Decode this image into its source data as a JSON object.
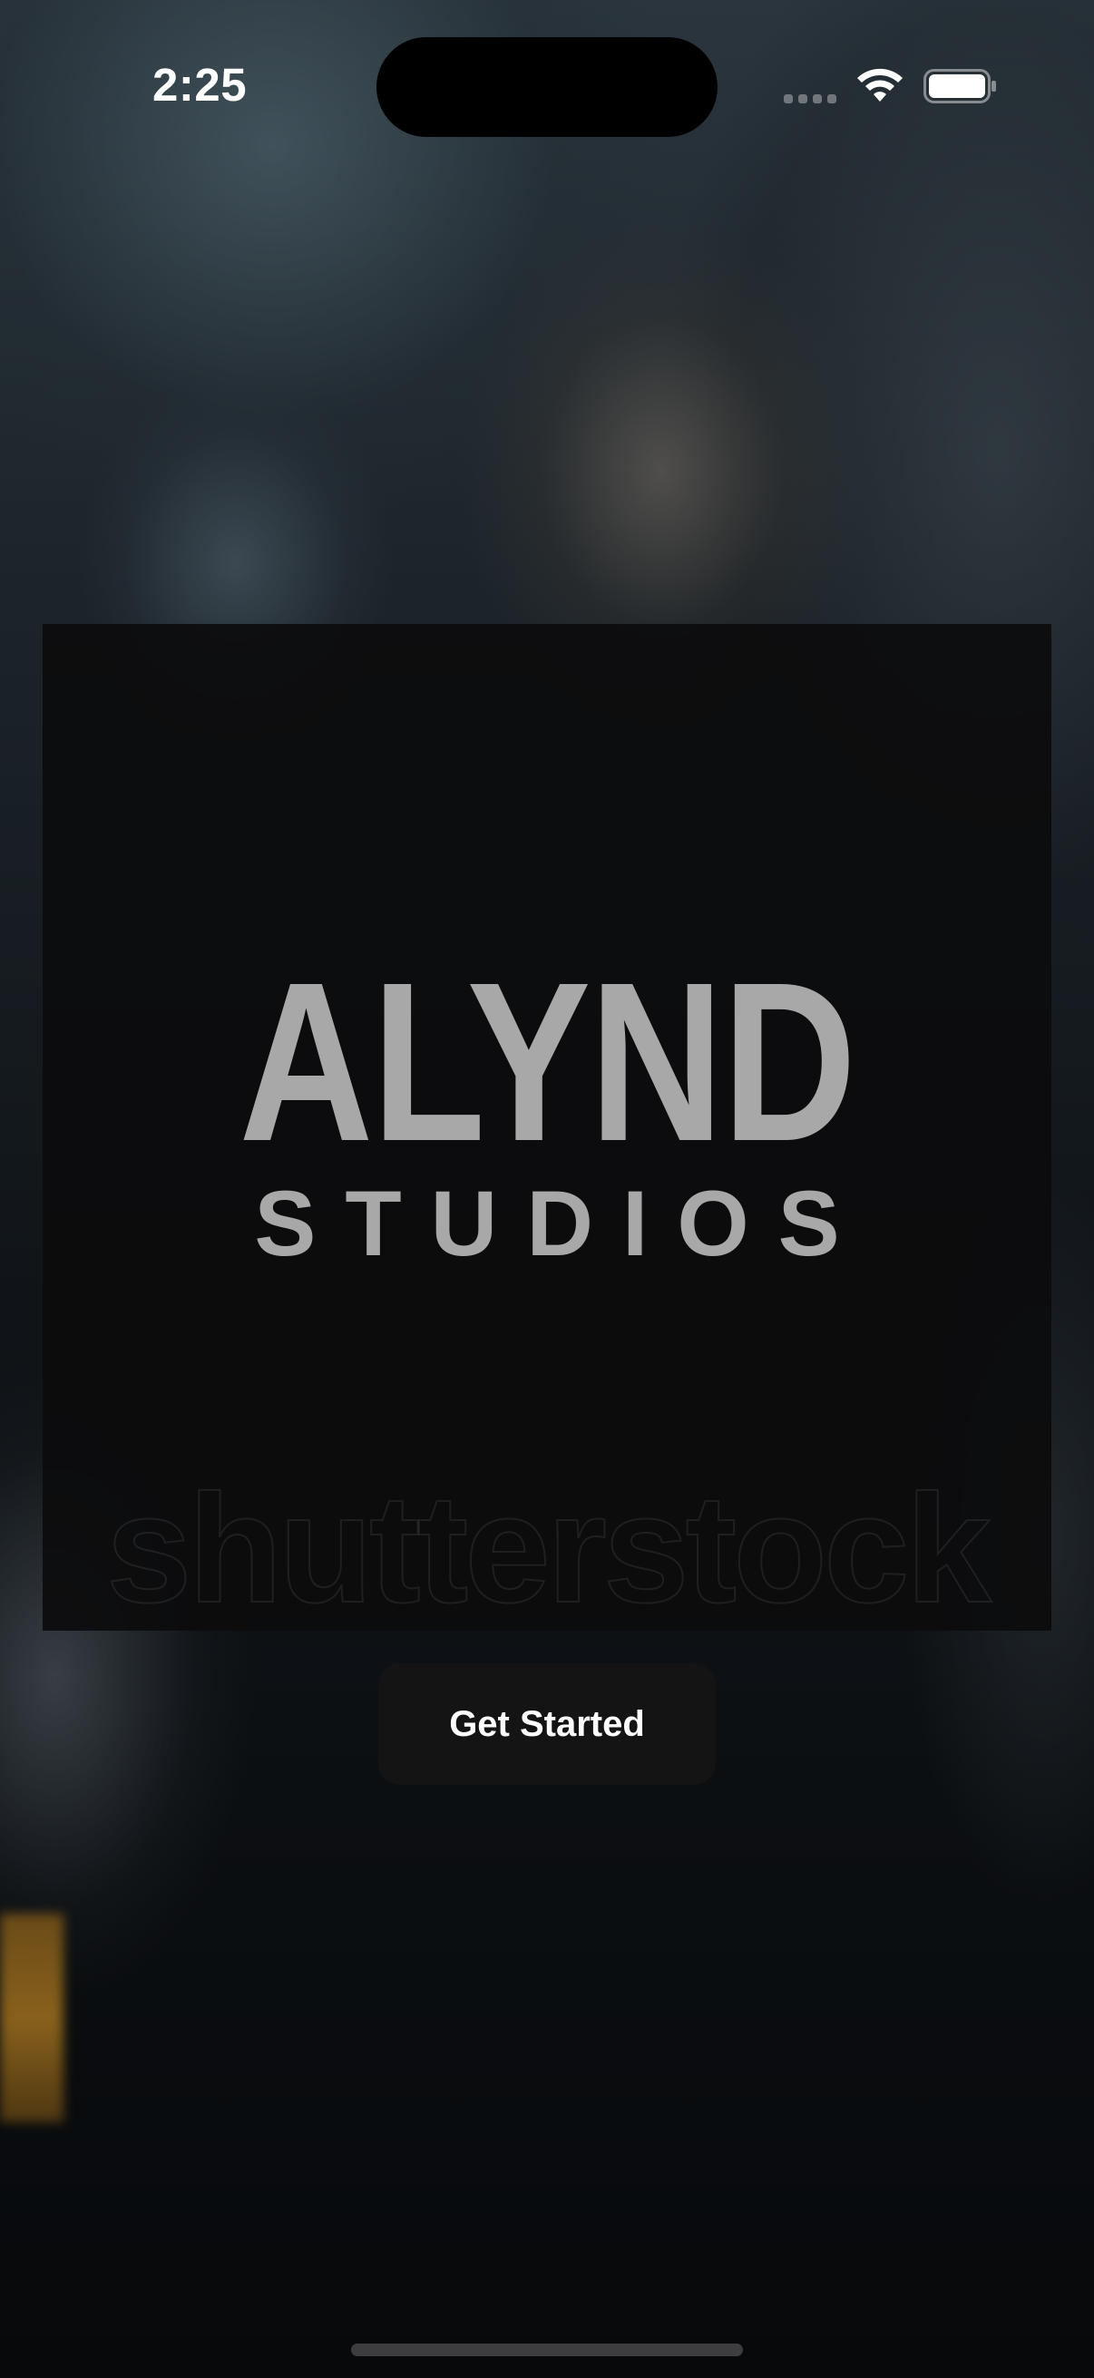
{
  "status_bar": {
    "time": "2:25",
    "icons": [
      "cellular-signal-icon",
      "wifi-icon",
      "battery-icon"
    ]
  },
  "background": {
    "description_icon": "boxing-background-video"
  },
  "splash": {
    "brand_name": "ALYND",
    "brand_subtitle": "STUDIOS",
    "watermark": "shutterstock"
  },
  "actions": {
    "get_started_label": "Get Started"
  },
  "colors": {
    "logo": "#a8a8a8",
    "button_bg": "#141414",
    "button_text": "#ffffff",
    "panel_bg": "#0c0c0d"
  }
}
